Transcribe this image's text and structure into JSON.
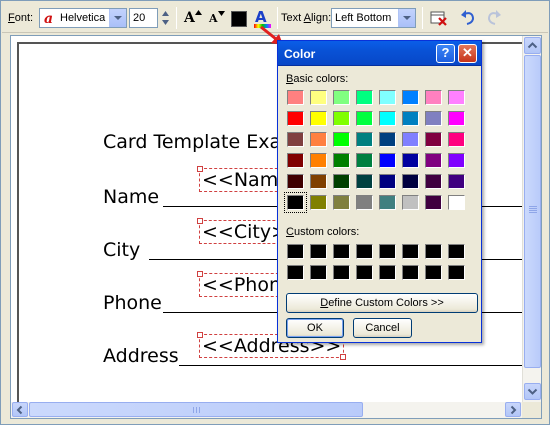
{
  "toolbar": {
    "font_label_pre": "",
    "font_label_key": "F",
    "font_label_post": "ont:",
    "font_value": "Helvetica",
    "font_size_value": "20",
    "text_align_label_pre": "Text ",
    "text_align_label_key": "A",
    "text_align_label_post": "lign:",
    "text_align_value": "Left Bottom",
    "current_color": "#000000",
    "increase_font_glyph": "A",
    "decrease_font_glyph": "A",
    "font_color_glyph": "A"
  },
  "document": {
    "title": "Card Template Exa",
    "rows": [
      {
        "label": "Name ",
        "field": "<<Name"
      },
      {
        "label": "City ",
        "field": "<<City>"
      },
      {
        "label": "Phone",
        "field": "<<Phon"
      },
      {
        "label": "Address",
        "field": "<<Address>>"
      }
    ]
  },
  "color_dialog": {
    "title": "Color",
    "help_glyph": "?",
    "close_glyph": "✕",
    "basic_label_key": "B",
    "basic_label_post": "asic colors:",
    "custom_label_key": "C",
    "custom_label_post": "ustom colors:",
    "define_button_key": "D",
    "define_button_post": "efine Custom Colors >>",
    "ok_label": "OK",
    "cancel_label": "Cancel",
    "basic_colors": [
      [
        "#ff8080",
        "#ffff80",
        "#80ff80",
        "#00ff80",
        "#80ffff",
        "#0080ff",
        "#ff80c0",
        "#ff80ff"
      ],
      [
        "#ff0000",
        "#ffff00",
        "#80ff00",
        "#00ff40",
        "#00ffff",
        "#0080c0",
        "#8080c0",
        "#ff00ff"
      ],
      [
        "#804040",
        "#ff8040",
        "#00ff00",
        "#008080",
        "#004080",
        "#8080ff",
        "#800040",
        "#ff0080"
      ],
      [
        "#800000",
        "#ff8000",
        "#008000",
        "#008040",
        "#0000ff",
        "#0000a0",
        "#800080",
        "#8000ff"
      ],
      [
        "#400000",
        "#804000",
        "#004000",
        "#004040",
        "#000080",
        "#000040",
        "#400040",
        "#400080"
      ],
      [
        "#000000",
        "#808000",
        "#808040",
        "#808080",
        "#408080",
        "#c0c0c0",
        "#400040",
        "#ffffff"
      ]
    ],
    "selected_color": "#000000",
    "custom_colors": [
      [
        "#000000",
        "#000000",
        "#000000",
        "#000000",
        "#000000",
        "#000000",
        "#000000",
        "#000000"
      ],
      [
        "#000000",
        "#000000",
        "#000000",
        "#000000",
        "#000000",
        "#000000",
        "#000000",
        "#000000"
      ]
    ]
  }
}
